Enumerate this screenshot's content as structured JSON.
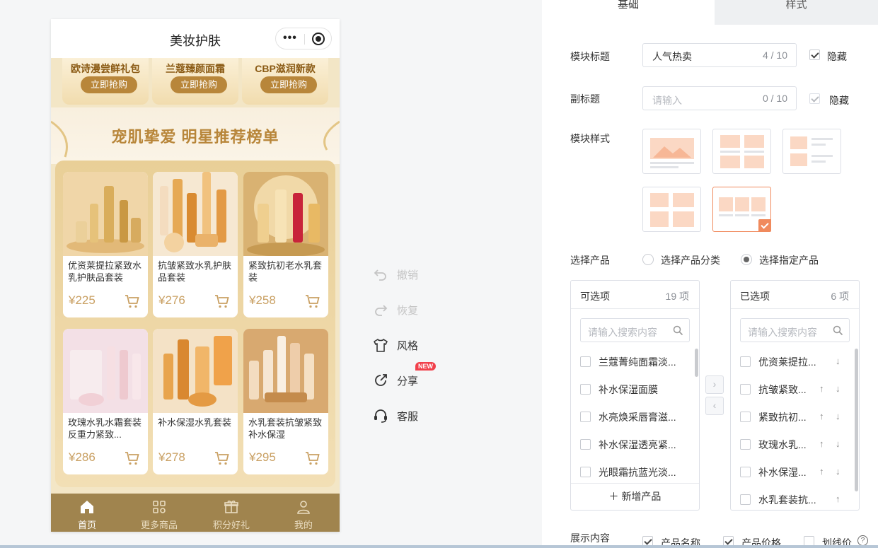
{
  "preview": {
    "nav_title": "美妆护肤",
    "capsule_dots": "•••",
    "promos": [
      {
        "title": "欧诗漫尝鲜礼包",
        "button": "立即抢购"
      },
      {
        "title": "兰蔻臻颜面霜",
        "button": "立即抢购"
      },
      {
        "title": "CBP滋润新款",
        "button": "立即抢购"
      }
    ],
    "banner_title": "宠肌挚爱 明星推荐榜单",
    "products": [
      {
        "name": "优资莱提拉紧致水乳护肤品套装",
        "price": "¥225"
      },
      {
        "name": "抗皱紧致水乳护肤品套装",
        "price": "¥276"
      },
      {
        "name": "紧致抗初老水乳套装",
        "price": "¥258"
      },
      {
        "name": "玫瑰水乳水霜套装反重力紧致...",
        "price": "¥286"
      },
      {
        "name": "补水保湿水乳套装",
        "price": "¥278"
      },
      {
        "name": "水乳套装抗皱紧致补水保湿",
        "price": "¥295"
      }
    ],
    "tabs": [
      {
        "label": "首页"
      },
      {
        "label": "更多商品"
      },
      {
        "label": "积分好礼"
      },
      {
        "label": "我的"
      }
    ]
  },
  "toolbar": {
    "undo": "撤销",
    "redo": "恢复",
    "style": "风格",
    "share": "分享",
    "share_badge": "NEW",
    "service": "客服"
  },
  "panel": {
    "tabs": {
      "basic": "基础",
      "style": "样式"
    },
    "title_label": "模块标题",
    "title_value": "人气热卖",
    "title_count": "4 / 10",
    "hide_label": "隐藏",
    "subtitle_label": "副标题",
    "subtitle_placeholder": "请输入",
    "subtitle_count": "0 / 10",
    "module_style_label": "模块样式",
    "select_product_label": "选择产品",
    "radio_category": "选择产品分类",
    "radio_specific": "选择指定产品",
    "available": {
      "title": "可选项",
      "count": "19 项",
      "search_placeholder": "请输入搜索内容",
      "items": [
        "兰蔻菁纯面霜淡...",
        "补水保湿面膜",
        "水亮焕采唇膏滋...",
        "补水保湿透亮紧...",
        "光眼霜抗蓝光淡..."
      ],
      "add_label": "新增产品"
    },
    "selected": {
      "title": "已选项",
      "count": "6 项",
      "search_placeholder": "请输入搜索内容",
      "items": [
        "优资莱提拉...",
        "抗皱紧致...",
        "紧致抗初...",
        "玫瑰水乳...",
        "补水保湿...",
        "水乳套装抗..."
      ]
    },
    "display_label": "展示内容",
    "display_name": "产品名称",
    "display_price": "产品价格",
    "display_strike": "划线价",
    "help_symbol": "?",
    "accent_color": "#f08a5d"
  }
}
